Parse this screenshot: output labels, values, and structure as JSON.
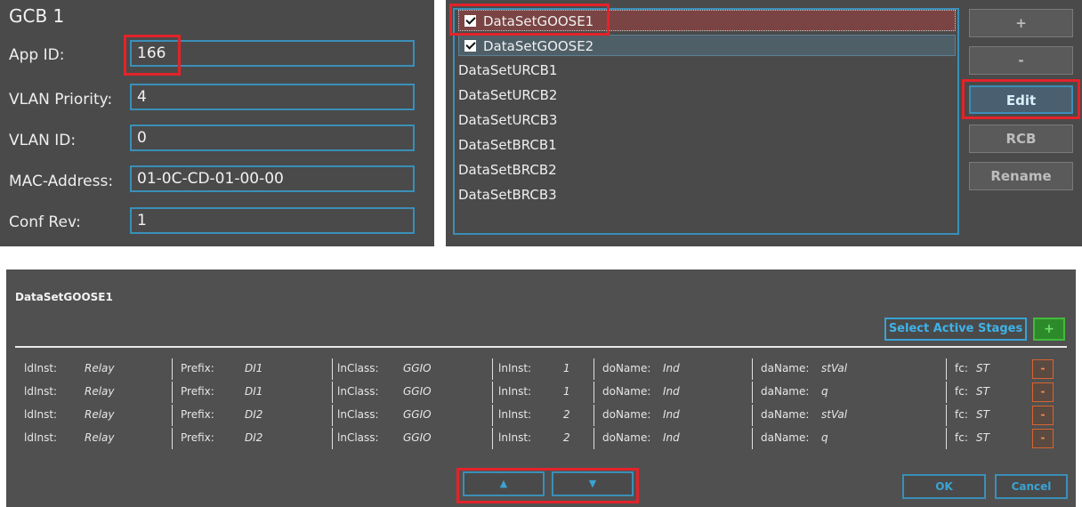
{
  "gcb": {
    "title": "GCB 1",
    "fields": [
      {
        "label": "App ID:",
        "value": "166"
      },
      {
        "label": "VLAN Priority:",
        "value": "4"
      },
      {
        "label": "VLAN ID:",
        "value": "0"
      },
      {
        "label": "MAC-Address:",
        "value": "01-0C-CD-01-00-00"
      },
      {
        "label": "Conf Rev:",
        "value": "1"
      }
    ]
  },
  "datasets": {
    "items": [
      {
        "label": "DataSetGOOSE1",
        "checked": true
      },
      {
        "label": "DataSetGOOSE2",
        "checked": true
      },
      {
        "label": "DataSetURCB1",
        "checked": false
      },
      {
        "label": "DataSetURCB2",
        "checked": false
      },
      {
        "label": "DataSetURCB3",
        "checked": false
      },
      {
        "label": "DataSetBRCB1",
        "checked": false
      },
      {
        "label": "DataSetBRCB2",
        "checked": false
      },
      {
        "label": "DataSetBRCB3",
        "checked": false
      }
    ],
    "buttons": {
      "add": "+",
      "remove": "-",
      "edit": "Edit",
      "rcb": "RCB",
      "rename": "Rename"
    }
  },
  "editor": {
    "title": "DataSetGOOSE1",
    "select_active_stages": "Select Active Stages",
    "add_label": "+",
    "field_labels": {
      "ldinst": "ldInst:",
      "prefix": "Prefix:",
      "lnclass": "lnClass:",
      "lninst": "lnInst:",
      "doname": "doName:",
      "daname": "daName:",
      "fc": "fc:"
    },
    "rows": [
      {
        "ldinst": "Relay",
        "prefix": "DI1",
        "lnclass": "GGIO",
        "lninst": "1",
        "doname": "Ind",
        "daname": "stVal",
        "fc": "ST"
      },
      {
        "ldinst": "Relay",
        "prefix": "DI1",
        "lnclass": "GGIO",
        "lninst": "1",
        "doname": "Ind",
        "daname": "q",
        "fc": "ST"
      },
      {
        "ldinst": "Relay",
        "prefix": "DI2",
        "lnclass": "GGIO",
        "lninst": "2",
        "doname": "Ind",
        "daname": "stVal",
        "fc": "ST"
      },
      {
        "ldinst": "Relay",
        "prefix": "DI2",
        "lnclass": "GGIO",
        "lninst": "2",
        "doname": "Ind",
        "daname": "q",
        "fc": "ST"
      }
    ],
    "delete_label": "-",
    "move_up": "▲",
    "move_down": "▼",
    "ok": "OK",
    "cancel": "Cancel"
  }
}
